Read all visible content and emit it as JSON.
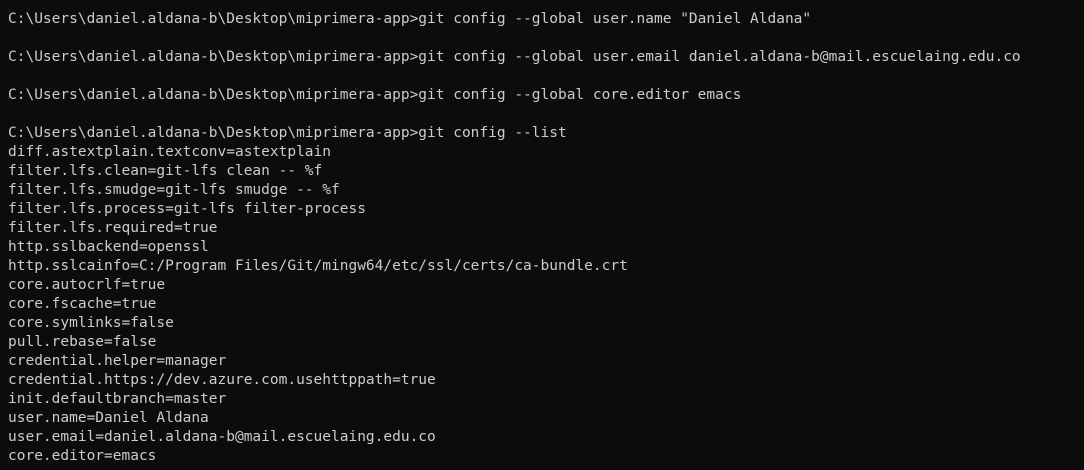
{
  "terminal": {
    "lines": [
      "C:\\Users\\daniel.aldana-b\\Desktop\\miprimera-app>git config --global user.name \"Daniel Aldana\"",
      "",
      "C:\\Users\\daniel.aldana-b\\Desktop\\miprimera-app>git config --global user.email daniel.aldana-b@mail.escuelaing.edu.co",
      "",
      "C:\\Users\\daniel.aldana-b\\Desktop\\miprimera-app>git config --global core.editor emacs",
      "",
      "C:\\Users\\daniel.aldana-b\\Desktop\\miprimera-app>git config --list",
      "diff.astextplain.textconv=astextplain",
      "filter.lfs.clean=git-lfs clean -- %f",
      "filter.lfs.smudge=git-lfs smudge -- %f",
      "filter.lfs.process=git-lfs filter-process",
      "filter.lfs.required=true",
      "http.sslbackend=openssl",
      "http.sslcainfo=C:/Program Files/Git/mingw64/etc/ssl/certs/ca-bundle.crt",
      "core.autocrlf=true",
      "core.fscache=true",
      "core.symlinks=false",
      "pull.rebase=false",
      "credential.helper=manager",
      "credential.https://dev.azure.com.usehttppath=true",
      "init.defaultbranch=master",
      "user.name=Daniel Aldana",
      "user.email=daniel.aldana-b@mail.escuelaing.edu.co",
      "core.editor=emacs"
    ]
  },
  "colors": {
    "background": "#0c0c0c",
    "foreground": "#cccccc"
  }
}
